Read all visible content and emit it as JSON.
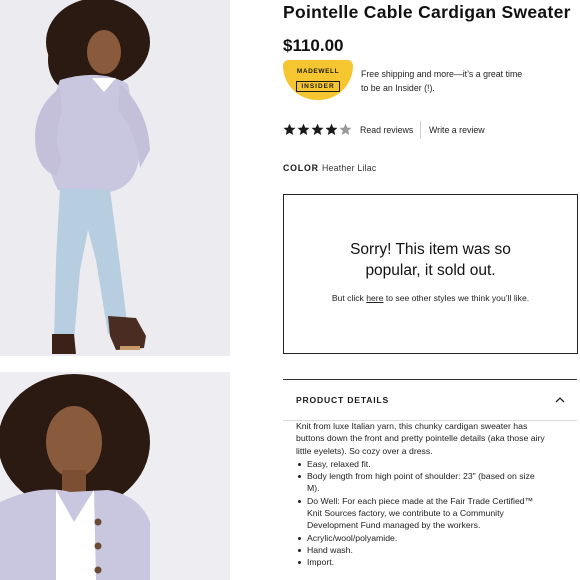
{
  "product": {
    "title": "Pointelle Cable Cardigan Sweater",
    "price": "$110.00",
    "color_label": "COLOR",
    "color_value": "Heather Lilac",
    "rating": 4,
    "rating_max": 5
  },
  "insider": {
    "badge_line1": "MADEWELL",
    "badge_line2": "INSIDER",
    "promo_text": "Free shipping and more—it’s a great time to be an Insider (!)."
  },
  "reviews": {
    "read_label": "Read reviews",
    "write_label": "Write a review"
  },
  "sold_out": {
    "heading": "Sorry! This item was so popular, it sold out.",
    "sub_before": "But click ",
    "sub_link": "here",
    "sub_after": " to see other styles we think you’ll like."
  },
  "details": {
    "title": "PRODUCT DETAILS",
    "description": "Knit from luxe Italian yarn, this chunky cardigan sweater has buttons down the front and pretty pointelle details (aka those airy little eyelets). So cozy over a dress.",
    "bullets": [
      "Easy, relaxed fit.",
      "Body length from high point of shoulder: 23\" (based on size M).",
      "Do Well: For each piece made at the Fair Trade Certified™ Knit Sources factory, we contribute to a Community Development Fund managed by the workers.",
      "Acrylic/wool/polyamide.",
      "Hand wash.",
      "Import."
    ]
  },
  "colors": {
    "badge": "#f6c630",
    "sweater": "#c9c6df",
    "jeans": "#b7cde0",
    "hair": "#2b1a12",
    "boots": "#4a2c22"
  },
  "icons": {
    "star": "star-icon",
    "chevron": "chevron-up-icon"
  }
}
